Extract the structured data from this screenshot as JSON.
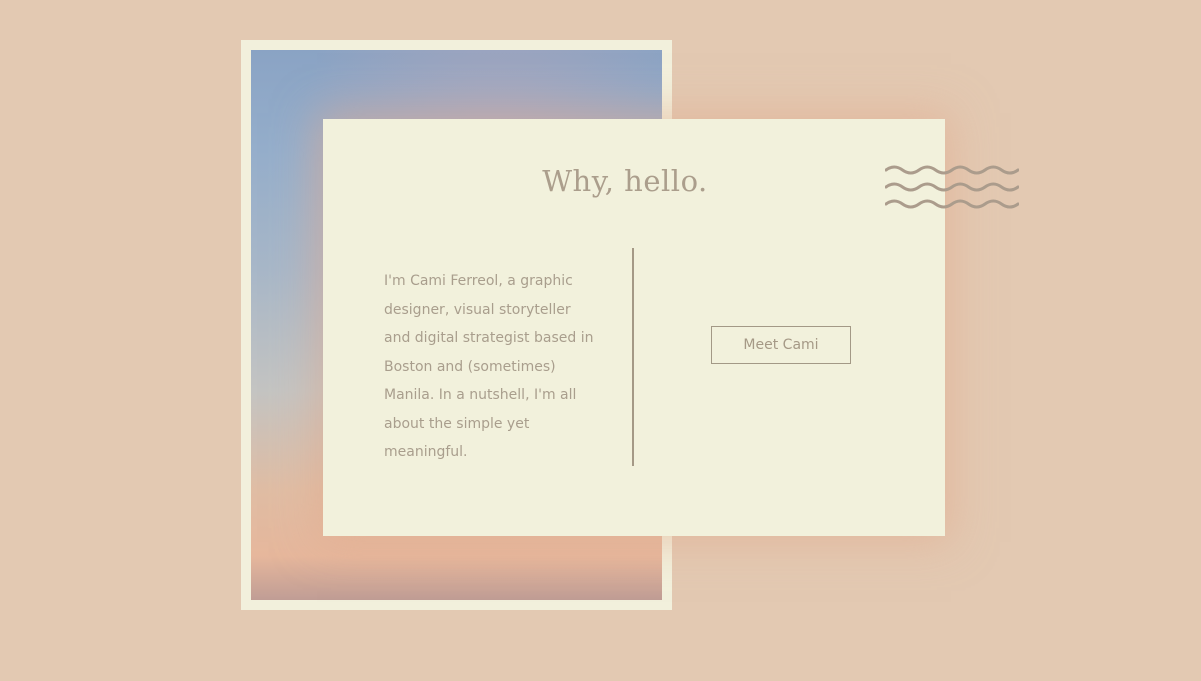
{
  "colors": {
    "background": "#e3c9b2",
    "card": "#f2f1dc",
    "text": "#a99e8d"
  },
  "postcard": {
    "heading": "Why, hello.",
    "postmark_icon": "wavy-lines-postmark-icon",
    "bio": "I'm Cami Ferreol, a graphic designer, visual storyteller and digital strategist based in Boston and (sometimes) Manila. In a nutshell, I'm all about the simple yet meaningful.",
    "button_label": "Meet Cami"
  }
}
